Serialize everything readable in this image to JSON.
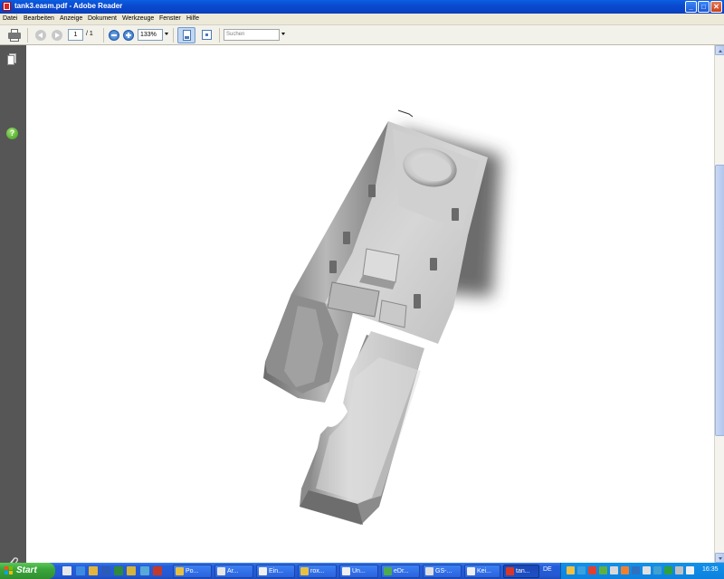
{
  "window": {
    "title": "tank3.easm.pdf - Adobe Reader",
    "minimize_label": "_",
    "maximize_label": "□",
    "close_label": "✕"
  },
  "menu": {
    "items": [
      {
        "label": "Datei"
      },
      {
        "label": "Bearbeiten"
      },
      {
        "label": "Anzeige"
      },
      {
        "label": "Dokument"
      },
      {
        "label": "Werkzeuge"
      },
      {
        "label": "Fenster"
      },
      {
        "label": "Hilfe"
      }
    ]
  },
  "toolbar": {
    "page_current": "1",
    "page_total": "/ 1",
    "zoom": "133%",
    "search_placeholder": "Suchen"
  },
  "navpane": {
    "help_label": "?"
  },
  "taskbar": {
    "start_label": "Start",
    "tasks": [
      {
        "label": "Po..."
      },
      {
        "label": "Ar..."
      },
      {
        "label": "Ein..."
      },
      {
        "label": "rox..."
      },
      {
        "label": "Un..."
      },
      {
        "label": "eDr..."
      },
      {
        "label": "GS-..."
      },
      {
        "label": "Kei..."
      },
      {
        "label": "tan..."
      }
    ],
    "language": "DE",
    "clock": "16:35"
  },
  "colors": {
    "title_bar": "#0a4ad0",
    "nav_pane": "#565656",
    "document_bg": "#ffffff",
    "taskbar": "#245edb",
    "start_button": "#3aa63a"
  }
}
